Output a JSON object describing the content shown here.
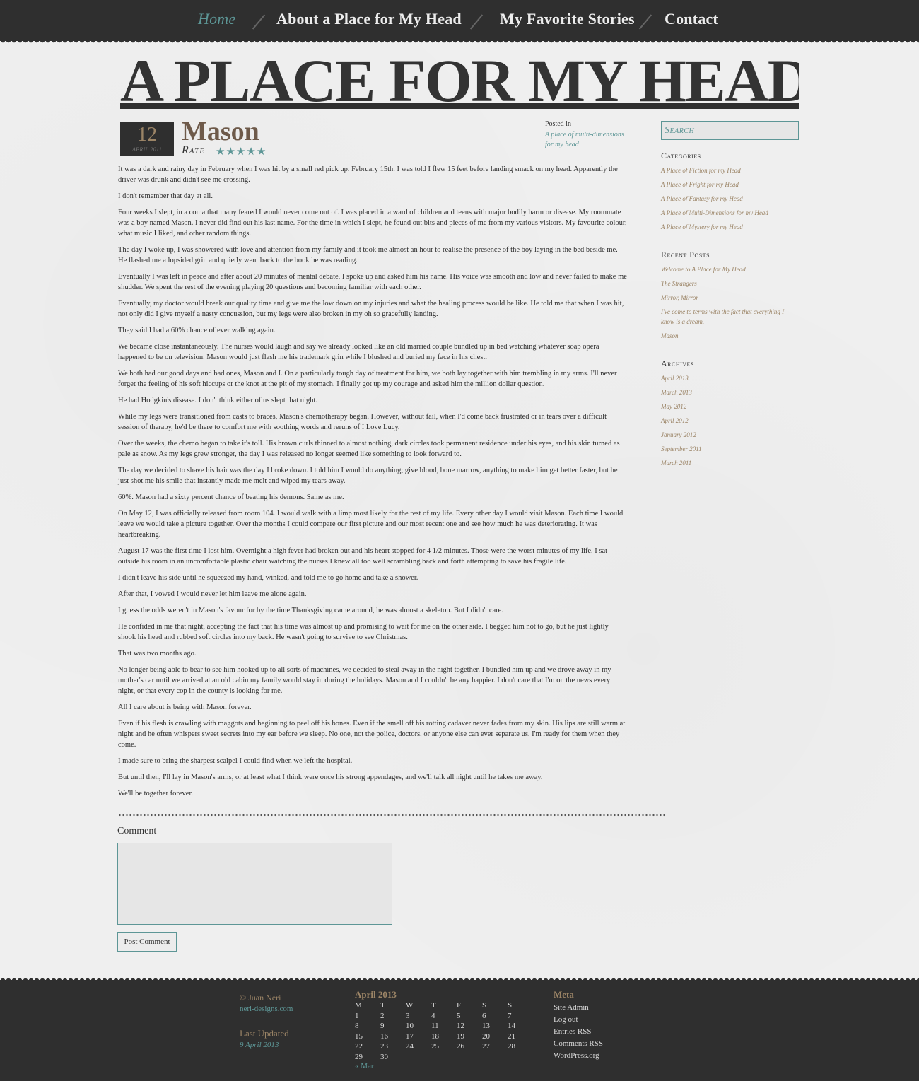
{
  "nav": {
    "items": [
      {
        "label": "Home",
        "active": true
      },
      {
        "label": "About a Place for My Head"
      },
      {
        "label": "My Favorite Stories"
      },
      {
        "label": "Contact"
      }
    ]
  },
  "site_title": "A PLACE FOR MY HEAD",
  "post": {
    "day": "12",
    "month": "April 2011",
    "title": "Mason",
    "rate_label": "Rate",
    "rating": 5,
    "posted_label": "Posted in",
    "posted_category": "A place of multi-dimensions for my head",
    "paragraphs": [
      "It was a dark and rainy day in February when I was hit by a small red pick up. February 15th. I was told I flew 15 feet before landing smack on my head. Apparently the driver was drunk and didn't see me crossing.",
      "I don't remember that day at all.",
      "Four weeks I slept, in a coma that many feared I would never come out of. I was placed in a ward of children and teens with major bodily harm or disease. My roommate was a boy named Mason. I never did find out his last name. For the time in which I slept, he found out bits and pieces of me from my various visitors. My favourite colour, what music I liked, and other random things.",
      "The day I woke up, I was showered with love and attention from my family and it took me almost an hour to realise the presence of the boy laying in the bed beside me. He flashed me a lopsided grin and quietly went back to the book he was reading.",
      "Eventually I was left in peace and after about 20 minutes of mental debate, I spoke up and asked him his name. His voice was smooth and low and never failed to make me shudder. We spent the rest of the evening playing 20 questions and becoming familiar with each other.",
      "Eventually, my doctor would break our quality time and give me the low down on my injuries and what the healing process would be like. He told me that when I was hit, not only did I give myself a nasty concussion, but my legs were also broken in my oh so gracefully landing.",
      "They said I had a 60% chance of ever walking again.",
      "We became close instantaneously. The nurses would laugh and say we already looked like an old married couple bundled up in bed watching whatever soap opera happened to be on television. Mason would just flash me his trademark grin while I blushed and buried my face in his chest.",
      "We both had our good days and bad ones, Mason and I. On a particularly tough day of treatment for him, we both lay together with him trembling in my arms. I'll never forget the feeling of his soft hiccups or the knot at the pit of my stomach. I finally got up my courage and asked him the million dollar question.",
      "He had Hodgkin's disease. I don't think either of us slept that night.",
      "While my legs were transitioned from casts to braces, Mason's chemotherapy began. However, without fail, when I'd come back frustrated or in tears over a difficult session of therapy, he'd be there to comfort me with soothing words and reruns of I Love Lucy.",
      "Over the weeks, the chemo began to take it's toll. His brown curls thinned to almost nothing, dark circles took permanent residence under his eyes, and his skin turned as pale as snow. As my legs grew stronger, the day I was released no longer seemed like something to look forward to.",
      "The day we decided to shave his hair was the day I broke down. I told him I would do anything; give blood, bone marrow, anything to make him get better faster, but he just shot me his smile that instantly made me melt and wiped my tears away.",
      "60%. Mason had a sixty percent chance of beating his demons. Same as me.",
      "On May 12, I was officially released from room 104. I would walk with a limp most likely for the rest of my life. Every other day I would visit Mason. Each time I would leave we would take a picture together. Over the months I could compare our first picture and our most recent one and see how much he was deteriorating. It was heartbreaking.",
      "August 17 was the first time I lost him. Overnight a high fever had broken out and his heart stopped for 4 1/2 minutes. Those were the worst minutes of my life. I sat outside his room in an uncomfortable plastic chair watching the nurses I knew all too well scrambling back and forth attempting to save his fragile life.",
      "I didn't leave his side until he squeezed my hand, winked, and told me to go home and take a shower.",
      "After that, I vowed I would never let him leave me alone again.",
      "I guess the odds weren't in Mason's favour for by the time Thanksgiving came around, he was almost a skeleton. But I didn't care.",
      "He confided in me that night, accepting the fact that his time was almost up and promising to wait for me on the other side. I begged him not to go, but he just lightly shook his head and rubbed soft circles into my back. He wasn't going to survive to see Christmas.",
      "That was two months ago.",
      "No longer being able to bear to see him hooked up to all sorts of machines, we decided to steal away in the night together. I bundled him up and we drove away in my mother's car until we arrived at an old cabin my family would stay in during the holidays. Mason and I couldn't be any happier. I don't care that I'm on the news every night, or that every cop in the county is looking for me.",
      "All I care about is being with Mason forever.",
      "Even if his flesh is crawling with maggots and beginning to peel off his bones. Even if the smell off his rotting cadaver never fades from my skin. His lips are still warm at night and he often whispers sweet secrets into my ear before we sleep. No one, not the police, doctors, or anyone else can ever separate us. I'm ready for them when they come.",
      "I made sure to bring the sharpest scalpel I could find when we left the hospital.",
      "But until then, I'll lay in Mason's arms, or at least what I think were once his strong appendages, and we'll talk all night until he takes me away.",
      "We'll be together forever."
    ]
  },
  "comment": {
    "label": "Comment",
    "button": "Post Comment"
  },
  "sidebar": {
    "search_placeholder": "Search",
    "categories_title": "Categories",
    "categories": [
      "A Place of Fiction for my Head",
      "A Place of Fright for my Head",
      "A Place of Fantasy for my Head",
      "A Place of Multi-Dimensions for my Head",
      "A Place of Mystery for my Head"
    ],
    "recent_title": "Recent Posts",
    "recent": [
      "Welcome to A Place for My Head",
      "The Strangers",
      "Mirror, Mirror",
      "I've come to terms with the fact that everything I know is a dream.",
      "Mason"
    ],
    "archives_title": "Archives",
    "archives": [
      "April 2013",
      "March 2013",
      "May 2012",
      "April 2012",
      "January 2012",
      "September 2011",
      "March 2011"
    ]
  },
  "footer": {
    "copyright": "© Juan Neri",
    "site": "neri-designs.com",
    "updated_label": "Last Updated",
    "updated_date": "9 April 2013",
    "calendar": {
      "title": "April 2013",
      "days": [
        "M",
        "T",
        "W",
        "T",
        "F",
        "S",
        "S"
      ],
      "weeks": [
        [
          "1",
          "2",
          "3",
          "4",
          "5",
          "6",
          "7"
        ],
        [
          "8",
          "9",
          "10",
          "11",
          "12",
          "13",
          "14"
        ],
        [
          "15",
          "16",
          "17",
          "18",
          "19",
          "20",
          "21"
        ],
        [
          "22",
          "23",
          "24",
          "25",
          "26",
          "27",
          "28"
        ],
        [
          "29",
          "30",
          "",
          "",
          "",
          "",
          ""
        ]
      ],
      "prev": "« Mar"
    },
    "meta_title": "Meta",
    "meta": [
      "Site Admin",
      "Log out",
      "Entries RSS",
      "Comments RSS",
      "WordPress.org"
    ]
  },
  "colors": {
    "dark": "#2f2f2f",
    "teal": "#5d9696",
    "tan": "#9b8466",
    "title_brown": "#6e5a4a"
  }
}
